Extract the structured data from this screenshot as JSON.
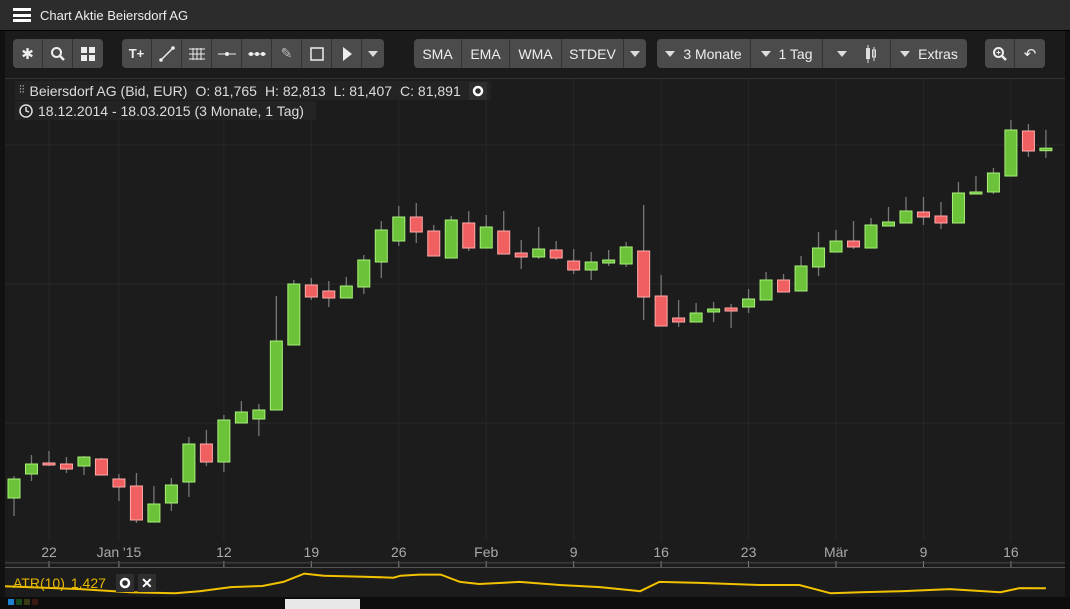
{
  "window": {
    "title": "Chart Aktie Beiersdorf AG"
  },
  "toolbar": {
    "group1": [
      "settings-icon",
      "search-icon",
      "layout-grid-icon"
    ],
    "group2": [
      "text-add-icon",
      "trendline-icon",
      "fibonacci-icon",
      "horizontal-line-icon",
      "horizontal-ray-icon",
      "pencil-icon",
      "rectangle-icon",
      "arrow-icon"
    ],
    "indicators": [
      "SMA",
      "EMA",
      "WMA",
      "STDEV"
    ],
    "period_label": "3 Monate",
    "interval_label": "1 Tag",
    "extras_label": "Extras"
  },
  "info": {
    "instrument": "Beiersdorf AG (Bid, EUR)",
    "open": "O: 81,765",
    "high": "H: 82,813",
    "low": "L: 81,407",
    "close": "C: 81,891",
    "range": "18.12.2014 - 18.03.2015 (3 Monate, 1 Tag)"
  },
  "indicator_panel": {
    "label": "ATR(10)",
    "value": "1,427"
  },
  "colors": {
    "up": "#6cc33a",
    "down": "#f06060",
    "atr": "#f2c200",
    "bg": "#1c1c1c"
  },
  "chart_data": {
    "type": "candlestick",
    "currency": "EUR",
    "ylim": [
      62.25,
      85.35
    ],
    "ohlc": [
      [
        64.4,
        65.5,
        63.5,
        65.35
      ],
      [
        65.6,
        66.55,
        65.25,
        66.1
      ],
      [
        66.15,
        66.75,
        66.0,
        66.05
      ],
      [
        66.1,
        66.45,
        65.65,
        65.85
      ],
      [
        66.0,
        66.5,
        65.55,
        66.45
      ],
      [
        66.35,
        66.4,
        65.55,
        65.55
      ],
      [
        65.35,
        65.6,
        64.25,
        64.95
      ],
      [
        65.0,
        65.65,
        63.15,
        63.3
      ],
      [
        63.2,
        65.0,
        63.2,
        64.1
      ],
      [
        64.15,
        65.4,
        63.75,
        65.05
      ],
      [
        65.2,
        67.45,
        64.45,
        67.1
      ],
      [
        67.1,
        67.8,
        66.0,
        66.2
      ],
      [
        66.2,
        68.55,
        65.7,
        68.3
      ],
      [
        68.15,
        69.25,
        68.15,
        68.7
      ],
      [
        68.35,
        69.1,
        67.5,
        68.8
      ],
      [
        68.8,
        74.5,
        68.8,
        72.25
      ],
      [
        72.05,
        75.3,
        72.05,
        75.1
      ],
      [
        75.05,
        75.4,
        74.3,
        74.45
      ],
      [
        74.75,
        75.25,
        73.95,
        74.4
      ],
      [
        74.4,
        75.45,
        74.4,
        75.0
      ],
      [
        74.95,
        76.55,
        74.6,
        76.3
      ],
      [
        76.2,
        78.25,
        75.4,
        77.8
      ],
      [
        77.25,
        79.0,
        77.0,
        78.45
      ],
      [
        78.45,
        79.15,
        77.15,
        77.7
      ],
      [
        77.75,
        78.05,
        76.5,
        76.5
      ],
      [
        76.4,
        78.5,
        76.4,
        78.3
      ],
      [
        78.15,
        78.75,
        76.75,
        76.9
      ],
      [
        76.9,
        78.55,
        76.9,
        77.95
      ],
      [
        77.75,
        78.75,
        76.6,
        76.6
      ],
      [
        76.65,
        77.3,
        75.85,
        76.45
      ],
      [
        76.45,
        77.95,
        76.35,
        76.85
      ],
      [
        76.8,
        77.25,
        76.3,
        76.4
      ],
      [
        76.25,
        76.85,
        75.6,
        75.8
      ],
      [
        75.8,
        76.7,
        75.3,
        76.2
      ],
      [
        76.15,
        76.8,
        76.0,
        76.3
      ],
      [
        76.1,
        77.2,
        75.95,
        76.95
      ],
      [
        76.75,
        79.05,
        73.3,
        74.45
      ],
      [
        74.5,
        75.55,
        73.0,
        73.0
      ],
      [
        73.4,
        74.3,
        72.95,
        73.2
      ],
      [
        73.2,
        74.15,
        73.2,
        73.65
      ],
      [
        73.7,
        74.2,
        73.2,
        73.85
      ],
      [
        73.9,
        74.1,
        72.9,
        73.75
      ],
      [
        73.95,
        74.85,
        73.65,
        74.35
      ],
      [
        74.3,
        75.7,
        74.3,
        75.3
      ],
      [
        75.3,
        75.6,
        74.7,
        74.7
      ],
      [
        74.75,
        76.5,
        74.75,
        76.0
      ],
      [
        75.95,
        77.7,
        75.5,
        76.9
      ],
      [
        76.7,
        77.8,
        76.7,
        77.25
      ],
      [
        77.25,
        78.25,
        76.85,
        76.95
      ],
      [
        76.9,
        78.4,
        76.9,
        78.05
      ],
      [
        78.0,
        78.95,
        78.0,
        78.2
      ],
      [
        78.15,
        79.45,
        78.15,
        78.75
      ],
      [
        78.7,
        79.45,
        78.05,
        78.45
      ],
      [
        78.5,
        79.2,
        77.85,
        78.15
      ],
      [
        78.15,
        80.2,
        78.15,
        79.65
      ],
      [
        79.6,
        80.5,
        79.6,
        79.7
      ],
      [
        79.7,
        80.9,
        79.6,
        80.65
      ],
      [
        80.5,
        83.3,
        80.5,
        82.8
      ],
      [
        82.75,
        83.1,
        81.45,
        81.75
      ],
      [
        81.765,
        82.813,
        81.407,
        81.891
      ]
    ],
    "x_ticks": [
      {
        "label": "22",
        "index": 2
      },
      {
        "label": "Jan '15",
        "index": 6
      },
      {
        "label": "12",
        "index": 12
      },
      {
        "label": "19",
        "index": 17
      },
      {
        "label": "26",
        "index": 22
      },
      {
        "label": "Feb",
        "index": 27
      },
      {
        "label": "9",
        "index": 32
      },
      {
        "label": "16",
        "index": 37
      },
      {
        "label": "23",
        "index": 42
      },
      {
        "label": "Mär",
        "index": 47
      },
      {
        "label": "9",
        "index": 52
      },
      {
        "label": "16",
        "index": 57
      }
    ],
    "atr_ylim": [
      1.0,
      2.4
    ],
    "atr": [
      [
        -0.8,
        1.53
      ],
      [
        3.8,
        1.38
      ],
      [
        6.6,
        1.23
      ],
      [
        9.2,
        1.18
      ],
      [
        10.6,
        1.28
      ],
      [
        12.4,
        1.48
      ],
      [
        14.2,
        1.53
      ],
      [
        15.4,
        1.73
      ],
      [
        16.6,
        2.13
      ],
      [
        17.7,
        2.03
      ],
      [
        20.0,
        1.98
      ],
      [
        21.7,
        1.93
      ],
      [
        22.1,
        2.03
      ],
      [
        23.2,
        2.08
      ],
      [
        24.4,
        2.08
      ],
      [
        25.5,
        1.73
      ],
      [
        26.6,
        1.63
      ],
      [
        28.9,
        1.73
      ],
      [
        31.2,
        1.58
      ],
      [
        33.5,
        1.48
      ],
      [
        35.8,
        1.28
      ],
      [
        36.9,
        1.73
      ],
      [
        39.2,
        1.68
      ],
      [
        42.6,
        1.58
      ],
      [
        44.9,
        1.58
      ],
      [
        46.7,
        1.18
      ],
      [
        48.4,
        1.23
      ],
      [
        50.7,
        1.28
      ],
      [
        53.5,
        1.38
      ],
      [
        56.4,
        1.23
      ],
      [
        57.5,
        1.43
      ],
      [
        59.0,
        1.427
      ]
    ]
  }
}
